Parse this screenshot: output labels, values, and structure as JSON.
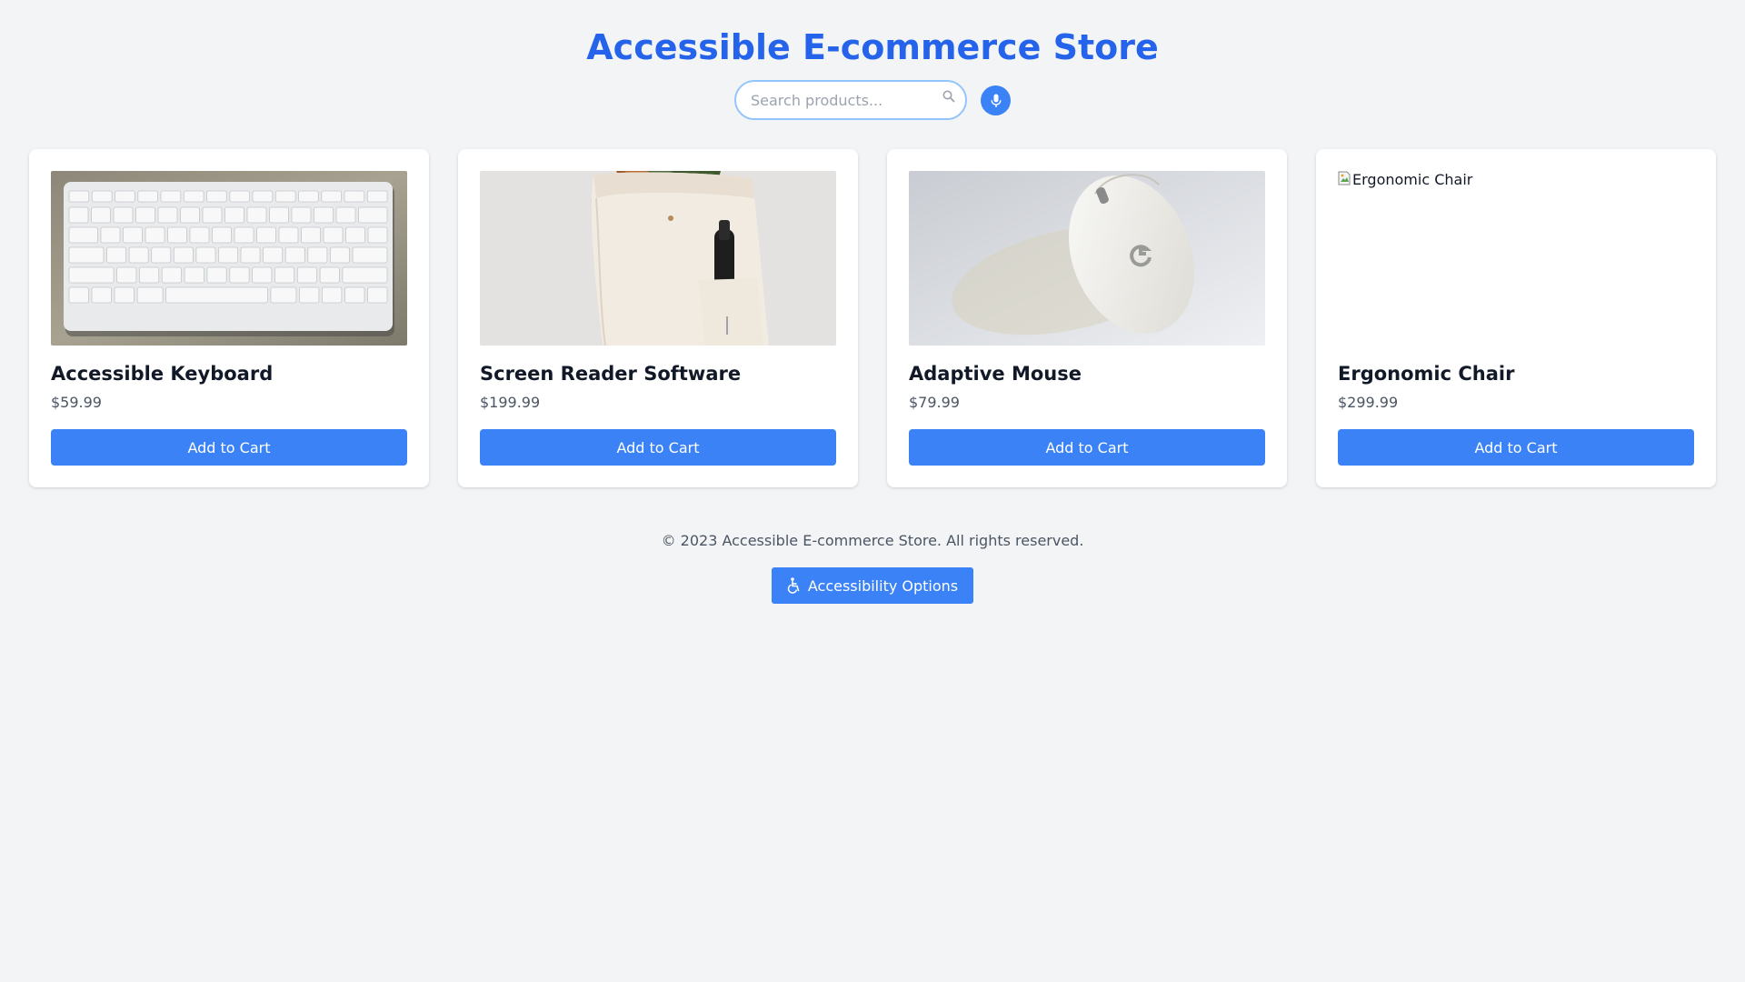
{
  "header": {
    "title": "Accessible E-commerce Store"
  },
  "search": {
    "placeholder": "Search products...",
    "value": "",
    "icon": "search-icon",
    "voice_icon": "microphone-icon"
  },
  "products": [
    {
      "name": "Accessible Keyboard",
      "price": "$59.99",
      "button_label": "Add to Cart",
      "image_alt": "Accessible Keyboard",
      "image_loaded": true
    },
    {
      "name": "Screen Reader Software",
      "price": "$199.99",
      "button_label": "Add to Cart",
      "image_alt": "Screen Reader Software",
      "image_loaded": true
    },
    {
      "name": "Adaptive Mouse",
      "price": "$79.99",
      "button_label": "Add to Cart",
      "image_alt": "Adaptive Mouse",
      "image_loaded": true
    },
    {
      "name": "Ergonomic Chair",
      "price": "$299.99",
      "button_label": "Add to Cart",
      "image_alt": "Ergonomic Chair",
      "image_loaded": false
    }
  ],
  "footer": {
    "copyright": "© 2023 Accessible E-commerce Store. All rights reserved.",
    "accessibility_button_label": "Accessibility Options",
    "accessibility_icon": "wheelchair-icon"
  },
  "colors": {
    "accent": "#3b82f6",
    "title": "#2563eb",
    "background": "#f3f4f6"
  }
}
